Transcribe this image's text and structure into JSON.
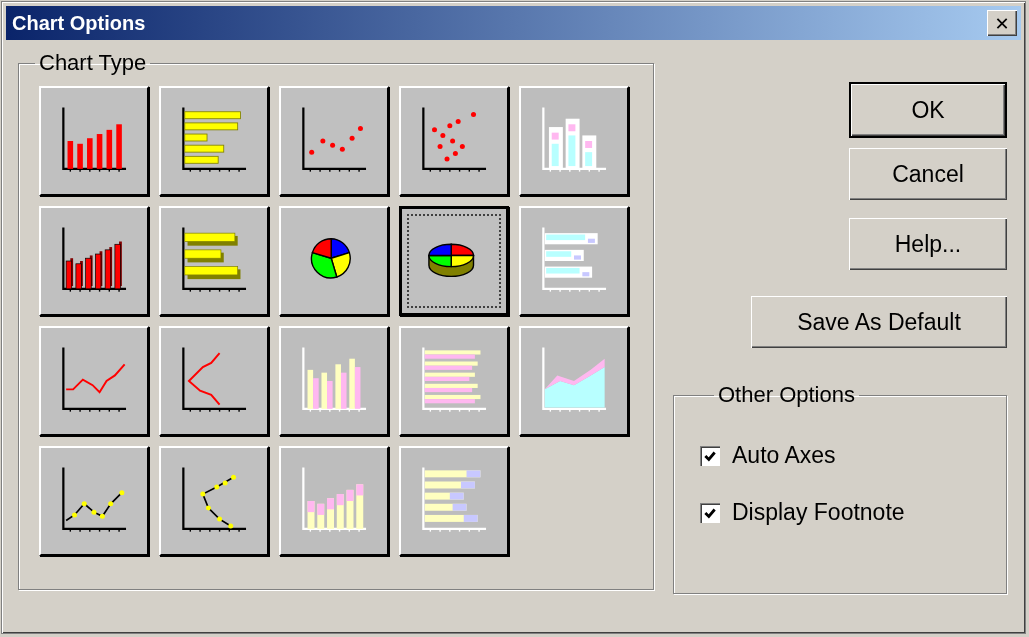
{
  "window": {
    "title": "Chart Options",
    "close_label": "✕"
  },
  "chart_type_group": {
    "title": "Chart Type",
    "chart_types": [
      {
        "kind": "bar",
        "selected": false,
        "disabled": false
      },
      {
        "kind": "hbar",
        "selected": false,
        "disabled": false
      },
      {
        "kind": "scatter",
        "selected": false,
        "disabled": false
      },
      {
        "kind": "scatter-v",
        "selected": false,
        "disabled": false
      },
      {
        "kind": "bar-stacked-3d",
        "selected": false,
        "disabled": true
      },
      {
        "kind": "bar-3d",
        "selected": false,
        "disabled": false
      },
      {
        "kind": "hbar-3d",
        "selected": false,
        "disabled": false
      },
      {
        "kind": "pie",
        "selected": false,
        "disabled": false
      },
      {
        "kind": "pie-3d",
        "selected": true,
        "disabled": false
      },
      {
        "kind": "hbar-stacked-3d",
        "selected": false,
        "disabled": true
      },
      {
        "kind": "line",
        "selected": false,
        "disabled": false
      },
      {
        "kind": "line-v",
        "selected": false,
        "disabled": false
      },
      {
        "kind": "bar-pair",
        "selected": false,
        "disabled": true
      },
      {
        "kind": "hbar-pair",
        "selected": false,
        "disabled": true
      },
      {
        "kind": "area",
        "selected": false,
        "disabled": true
      },
      {
        "kind": "line-points",
        "selected": false,
        "disabled": false
      },
      {
        "kind": "line-points-v",
        "selected": false,
        "disabled": false
      },
      {
        "kind": "bar-stacked",
        "selected": false,
        "disabled": true
      },
      {
        "kind": "hbar-stacked",
        "selected": false,
        "disabled": true
      }
    ]
  },
  "buttons": [
    {
      "label": "OK",
      "default": true
    },
    {
      "label": "Cancel",
      "default": false
    },
    {
      "label": "Help...",
      "default": false
    },
    {
      "label": "Save As Default",
      "default": false
    }
  ],
  "other_options": {
    "title": "Other Options",
    "checkboxes": [
      {
        "label": "Auto Axes",
        "checked": true
      },
      {
        "label": "Display Footnote",
        "checked": true
      }
    ]
  }
}
